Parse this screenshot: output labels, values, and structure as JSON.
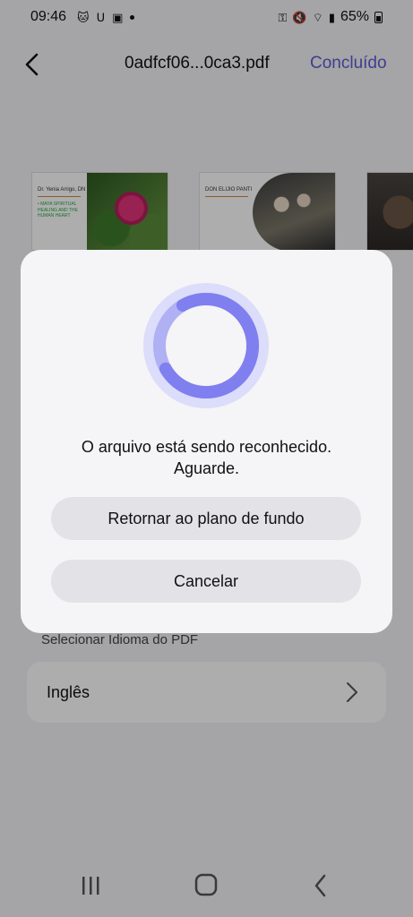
{
  "status_bar": {
    "time": "09:46",
    "battery": "65%"
  },
  "header": {
    "file_name": "0adfcf06...0ca3.pdf",
    "done_label": "Concluído"
  },
  "thumbnails": [
    {
      "title": "Dr. Yenia Arrigo, DN",
      "body": "• MAYA SPIRITUAL HEALING AND THE HUMAN HEART"
    },
    {
      "title": "DON ELIJIO PANTI",
      "body": ""
    }
  ],
  "language": {
    "section_label": "Selecionar Idioma do PDF",
    "value": "Inglês"
  },
  "dialog": {
    "message_line1": "O arquivo está sendo reconhecido.",
    "message_line2": "Aguarde.",
    "background_button": "Retornar ao plano de fundo",
    "cancel_button": "Cancelar",
    "spinner_color": "#7f7ff0",
    "progress": 0.75
  },
  "colors": {
    "accent": "#5b5bd6",
    "page_bg": "#f3f2f5",
    "dialog_bg": "#f5f4f6"
  }
}
